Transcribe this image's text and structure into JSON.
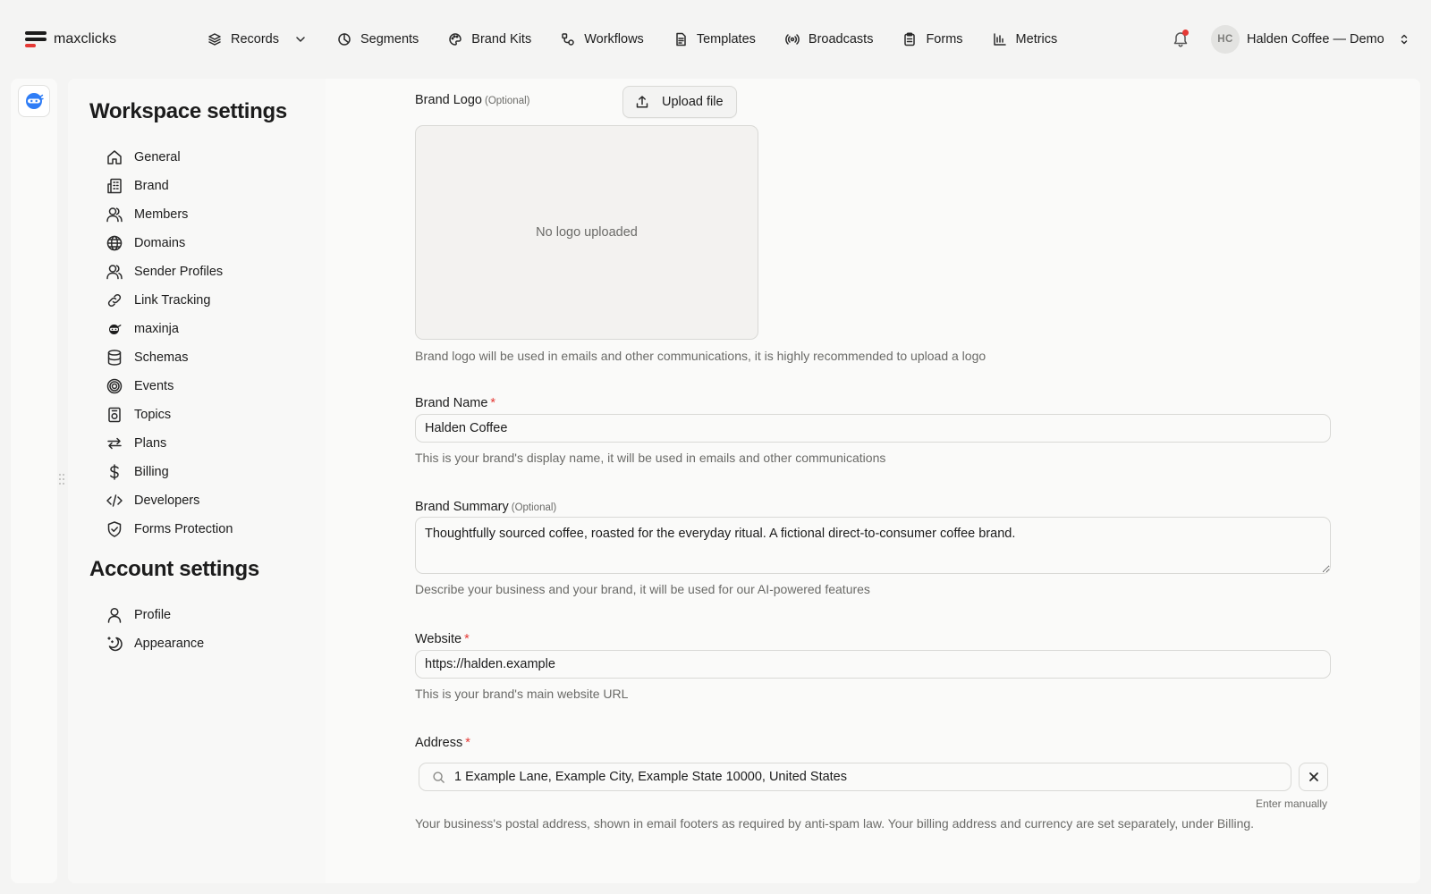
{
  "app": {
    "name": "maxclicks"
  },
  "nav": {
    "items": [
      {
        "label": "Records",
        "icon": "layers-icon",
        "has_dropdown": true
      },
      {
        "label": "Segments",
        "icon": "pie-icon"
      },
      {
        "label": "Brand Kits",
        "icon": "palette-icon"
      },
      {
        "label": "Workflows",
        "icon": "workflow-icon"
      },
      {
        "label": "Templates",
        "icon": "document-icon"
      },
      {
        "label": "Broadcasts",
        "icon": "broadcast-icon"
      },
      {
        "label": "Forms",
        "icon": "clipboard-icon"
      },
      {
        "label": "Metrics",
        "icon": "bar-chart-icon"
      }
    ]
  },
  "account": {
    "initials": "HC",
    "name": "Halden Coffee — Demo",
    "has_notification": true
  },
  "workspace_settings": {
    "title": "Workspace settings",
    "items": [
      {
        "label": "General",
        "icon": "home-icon"
      },
      {
        "label": "Brand",
        "icon": "building-icon"
      },
      {
        "label": "Members",
        "icon": "users-icon"
      },
      {
        "label": "Domains",
        "icon": "globe-icon"
      },
      {
        "label": "Sender Profiles",
        "icon": "users-icon"
      },
      {
        "label": "Link Tracking",
        "icon": "link-icon"
      },
      {
        "label": "maxinja",
        "icon": "ninja-icon"
      },
      {
        "label": "Schemas",
        "icon": "database-icon"
      },
      {
        "label": "Events",
        "icon": "target-icon"
      },
      {
        "label": "Topics",
        "icon": "topic-icon"
      },
      {
        "label": "Plans",
        "icon": "repeat-icon"
      },
      {
        "label": "Billing",
        "icon": "dollar-icon"
      },
      {
        "label": "Developers",
        "icon": "code-icon"
      },
      {
        "label": "Forms Protection",
        "icon": "shield-check-icon"
      }
    ]
  },
  "account_settings": {
    "title": "Account settings",
    "items": [
      {
        "label": "Profile",
        "icon": "user-icon"
      },
      {
        "label": "Appearance",
        "icon": "moon-icon"
      }
    ]
  },
  "form": {
    "brand_logo": {
      "label": "Brand Logo",
      "optional": "(Optional)",
      "upload_label": "Upload file",
      "empty_text": "No logo uploaded",
      "help": "Brand logo will be used in emails and other communications, it is highly recommended to upload a logo"
    },
    "brand_name": {
      "label": "Brand Name",
      "required_mark": "*",
      "value": "Halden Coffee",
      "help": "This is your brand's display name, it will be used in emails and other communications"
    },
    "brand_summary": {
      "label": "Brand Summary",
      "optional": "(Optional)",
      "value": "Thoughtfully sourced coffee, roasted for the everyday ritual. A fictional direct-to-consumer coffee brand.",
      "help": "Describe your business and your brand, it will be used for our AI-powered features"
    },
    "website": {
      "label": "Website",
      "required_mark": "*",
      "value": "https://halden.example",
      "help": "This is your brand's main website URL"
    },
    "address": {
      "label": "Address",
      "required_mark": "*",
      "value": "1 Example Lane, Example City, Example State 10000, United States",
      "enter_manually": "Enter manually",
      "help": "Your business's postal address, shown in email footers as required by anti-spam law. Your billing address and currency are set separately, under Billing."
    }
  },
  "colors": {
    "accent_red": "#e53935",
    "rail_icon_blue": "#2f7df6"
  }
}
